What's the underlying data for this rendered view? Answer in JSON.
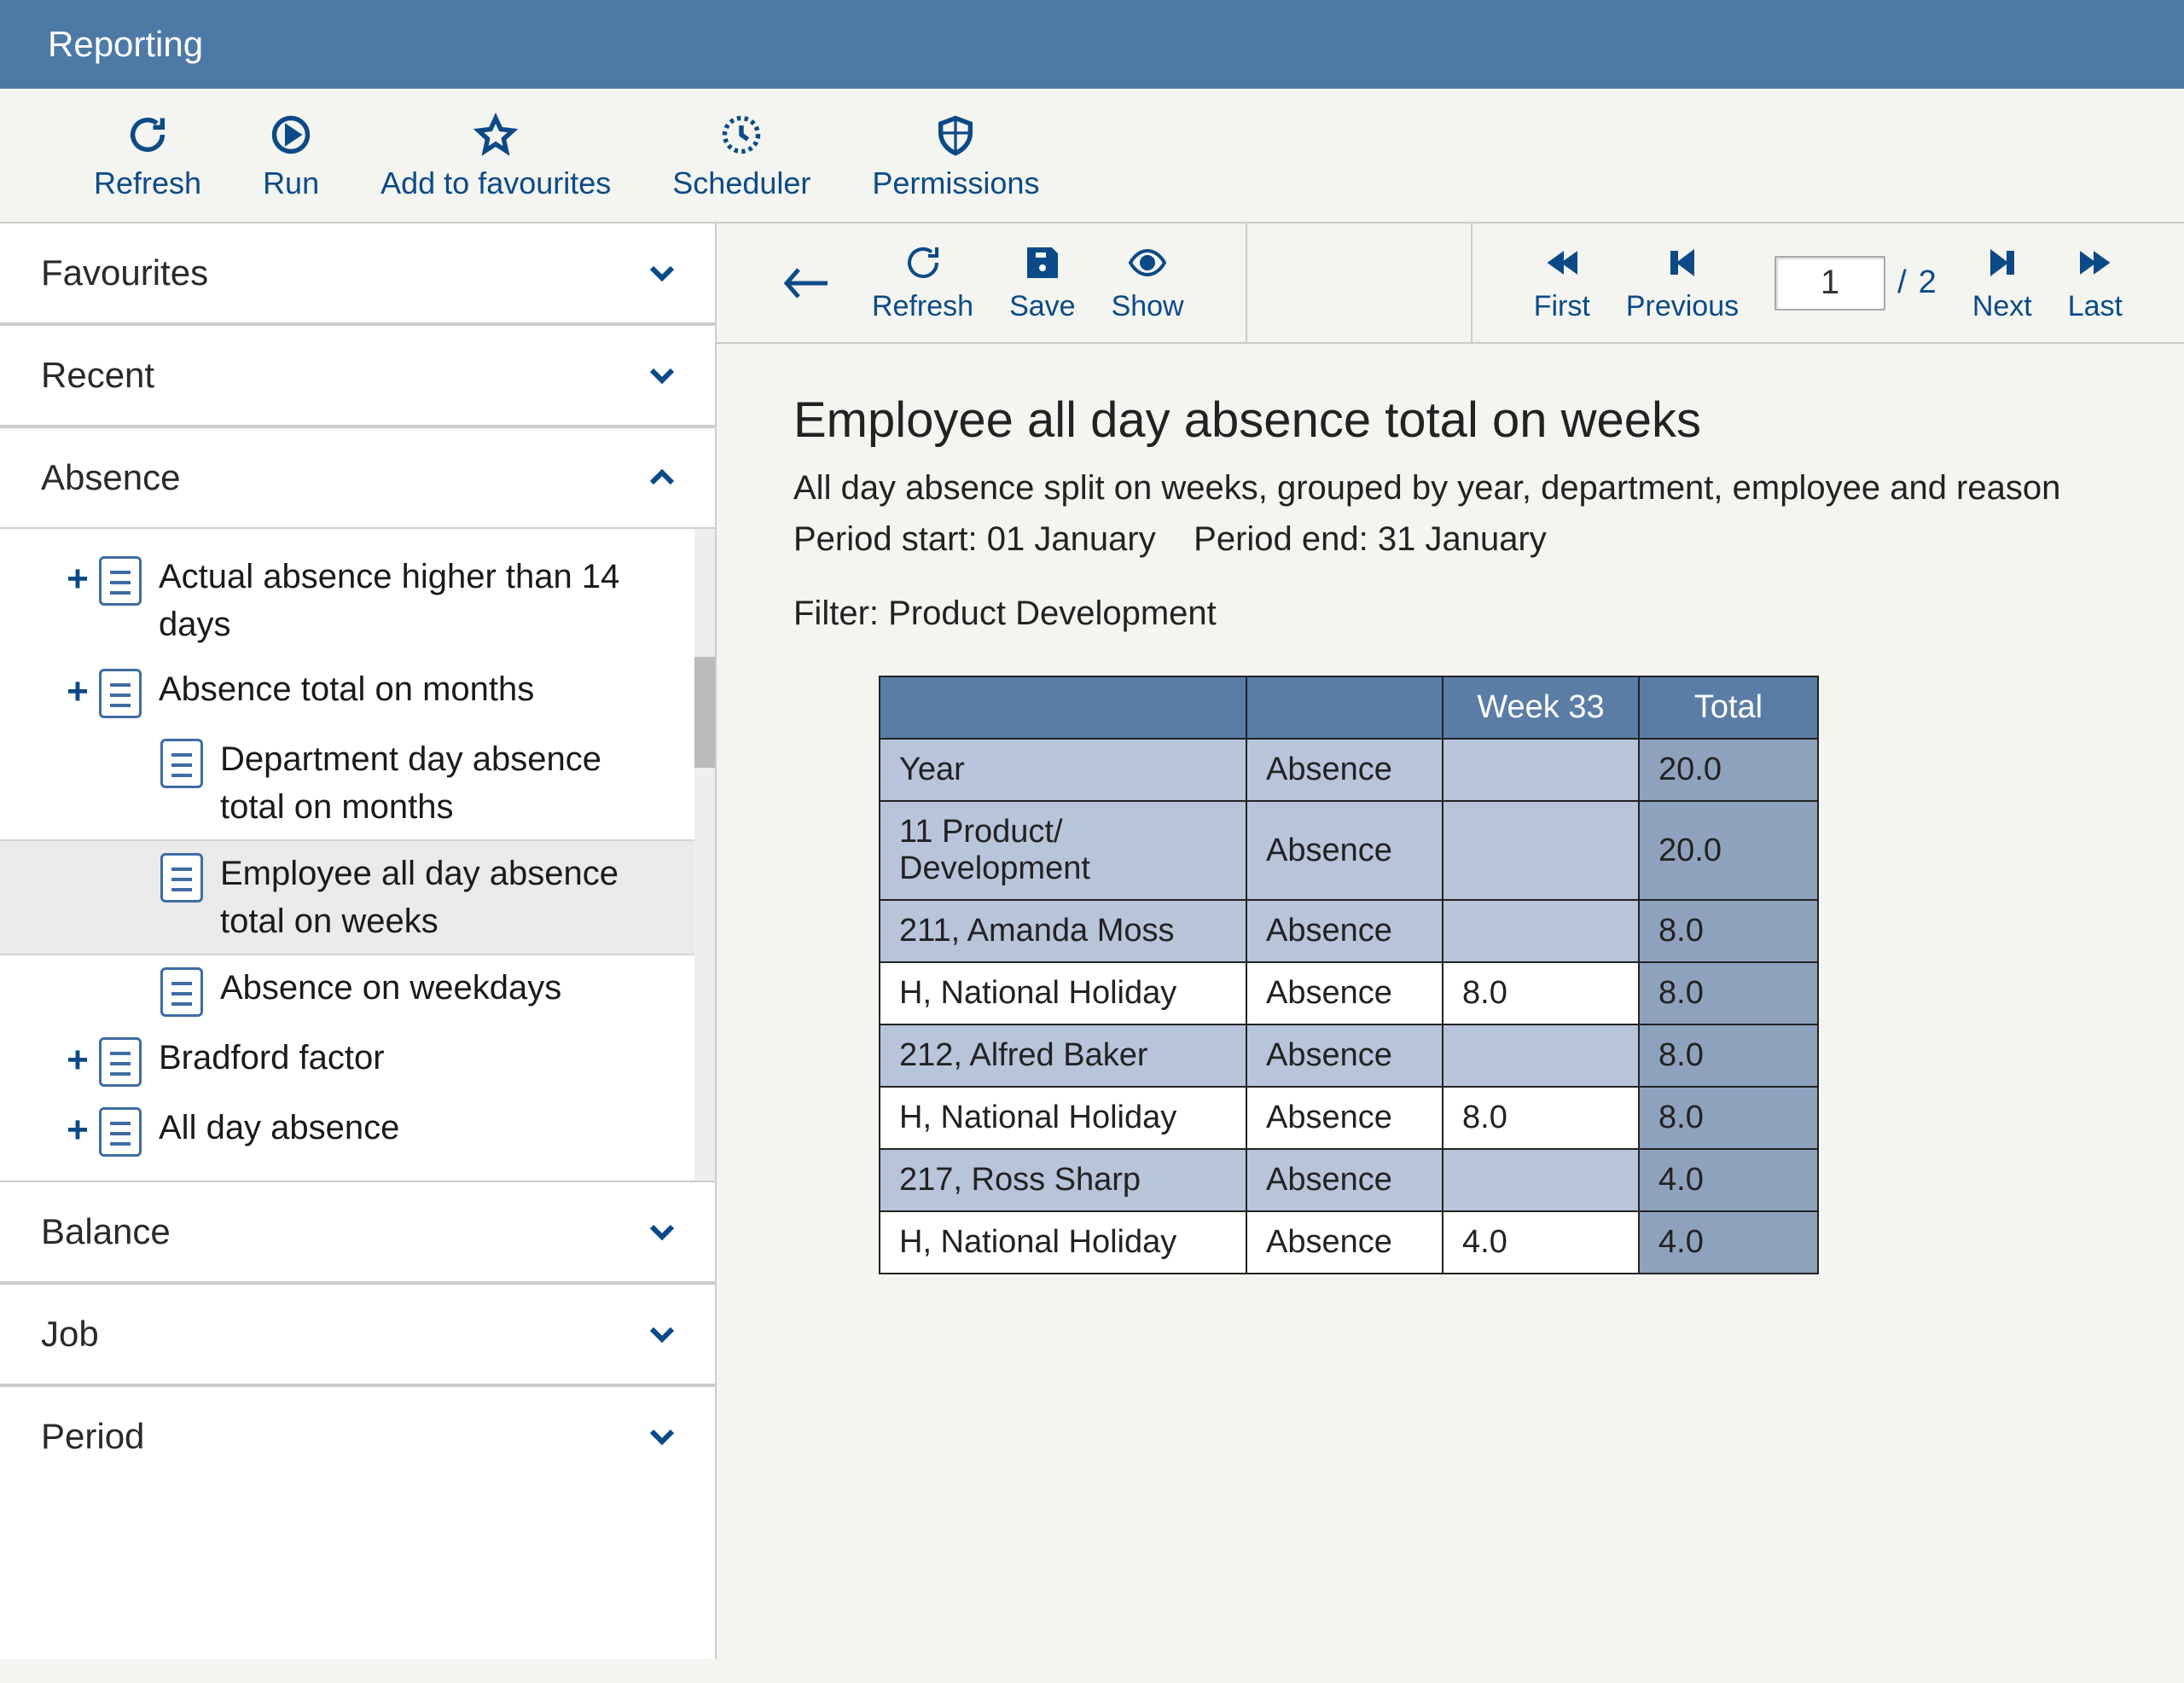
{
  "header": {
    "title": "Reporting"
  },
  "toolbar": [
    {
      "key": "refresh",
      "label": "Refresh"
    },
    {
      "key": "run",
      "label": "Run"
    },
    {
      "key": "favourites",
      "label": "Add to favourites"
    },
    {
      "key": "scheduler",
      "label": "Scheduler"
    },
    {
      "key": "permissions",
      "label": "Permissions"
    }
  ],
  "sidebar": {
    "sections": [
      {
        "key": "favourites",
        "label": "Favourites",
        "expanded": false
      },
      {
        "key": "recent",
        "label": "Recent",
        "expanded": false
      },
      {
        "key": "absence",
        "label": "Absence",
        "expanded": true,
        "items": [
          {
            "label": "Actual absence higher than 14 days",
            "expandable": true,
            "child": false,
            "selected": false
          },
          {
            "label": "Absence total on months",
            "expandable": true,
            "child": false,
            "selected": false
          },
          {
            "label": "Department day absence total on months",
            "expandable": false,
            "child": true,
            "selected": false
          },
          {
            "label": "Employee all day absence total on weeks",
            "expandable": false,
            "child": true,
            "selected": true
          },
          {
            "label": "Absence on weekdays",
            "expandable": false,
            "child": true,
            "selected": false
          },
          {
            "label": "Bradford factor",
            "expandable": true,
            "child": false,
            "selected": false
          },
          {
            "label": "All day absence",
            "expandable": true,
            "child": false,
            "selected": false
          }
        ]
      },
      {
        "key": "balance",
        "label": "Balance",
        "expanded": false
      },
      {
        "key": "job",
        "label": "Job",
        "expanded": false
      },
      {
        "key": "period",
        "label": "Period",
        "expanded": false
      }
    ]
  },
  "viewer": {
    "left": [
      {
        "key": "refresh",
        "label": "Refresh"
      },
      {
        "key": "save",
        "label": "Save"
      },
      {
        "key": "show",
        "label": "Show"
      }
    ],
    "nav": {
      "first": "First",
      "previous": "Previous",
      "next": "Next",
      "last": "Last",
      "page": "1",
      "total": "2"
    }
  },
  "report": {
    "title": "Employee all day absence total on weeks",
    "subtitle": "All day absence split on weeks, grouped by year, department, employee and reason",
    "period_start_label": "Period start:",
    "period_start_value": "01 January",
    "period_end_label": "Period end:",
    "period_end_value": "31 January",
    "filter_label": "Filter:",
    "filter_value": "Product Development"
  },
  "chart_data": {
    "type": "table",
    "columns": [
      "",
      "",
      "Week 33",
      "Total"
    ],
    "rows": [
      {
        "label": "Year",
        "type": "Absence",
        "week33": "",
        "total": "20.0",
        "shade": 1
      },
      {
        "label": "11 Product/ Development",
        "type": "Absence",
        "week33": "",
        "total": "20.0",
        "shade": 1
      },
      {
        "label": "211, Amanda Moss",
        "type": "Absence",
        "week33": "",
        "total": "8.0",
        "shade": 1
      },
      {
        "label": "H, National Holiday",
        "type": "Absence",
        "week33": "8.0",
        "total": "8.0",
        "shade": 2
      },
      {
        "label": "212, Alfred Baker",
        "type": "Absence",
        "week33": "",
        "total": "8.0",
        "shade": 1
      },
      {
        "label": "H, National Holiday",
        "type": "Absence",
        "week33": "8.0",
        "total": "8.0",
        "shade": 2
      },
      {
        "label": "217, Ross Sharp",
        "type": "Absence",
        "week33": "",
        "total": "4.0",
        "shade": 1
      },
      {
        "label": "H, National Holiday",
        "type": "Absence",
        "week33": "4.0",
        "total": "4.0",
        "shade": 2
      }
    ]
  }
}
